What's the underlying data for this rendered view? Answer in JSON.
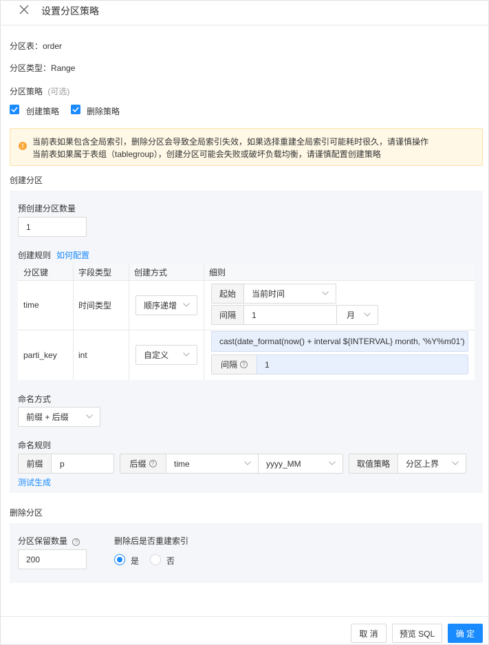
{
  "header": {
    "title": "设置分区策略"
  },
  "info": {
    "table_label": "分区表：order",
    "type_label": "分区类型：Range",
    "strategy_label": "分区策略",
    "strategy_optional": "(可选)"
  },
  "checks": {
    "create": "创建策略",
    "delete": "删除策略"
  },
  "alert": {
    "line1": "当前表如果包含全局索引，删除分区会导致全局索引失效，如果选择重建全局索引可能耗时很久，请谨慎操作",
    "line2": "当前表如果属于表组（tablegroup），创建分区可能会失败或破坏负载均衡，请谨慎配置创建策略"
  },
  "create_section": {
    "title": "创建分区",
    "precreate_label": "预创建分区数量",
    "precreate_value": "1",
    "rule_label": "创建规则",
    "how_link": "如何配置",
    "columns": [
      "分区键",
      "字段类型",
      "创建方式",
      "细则"
    ],
    "rows": [
      {
        "key": "time",
        "type": "时间类型",
        "method": "顺序递增",
        "start_label": "起始",
        "start_value": "当前时间",
        "interval_label": "间隔",
        "interval_value": "1",
        "interval_unit": "月"
      },
      {
        "key": "parti_key",
        "type": "int",
        "method": "自定义",
        "expression": "cast(date_format(now() + interval ${INTERVAL} month, '%Y%m01')",
        "interval_label": "间隔",
        "interval_value": "1"
      }
    ],
    "naming_mode_label": "命名方式",
    "naming_mode_value": "前缀 + 后缀",
    "naming_rule_label": "命名规则",
    "prefix_label": "前缀",
    "prefix_value": "p",
    "suffix_label": "后缀",
    "suffix_field": "time",
    "suffix_format": "yyyy_MM",
    "value_strategy_label": "取值策略",
    "value_strategy_value": "分区上界",
    "test_link": "测试生成"
  },
  "delete_section": {
    "title": "删除分区",
    "keep_label": "分区保留数量",
    "keep_value": "200",
    "rebuild_label": "删除后是否重建索引",
    "yes": "是",
    "no": "否"
  },
  "footer": {
    "cancel": "取 消",
    "preview": "预览 SQL",
    "confirm": "确 定"
  },
  "colors": {
    "primary": "#1a8bff",
    "warning": "#fba73a",
    "alert_bg": "#fff8e6",
    "panel_bg": "#f4f6f9"
  }
}
